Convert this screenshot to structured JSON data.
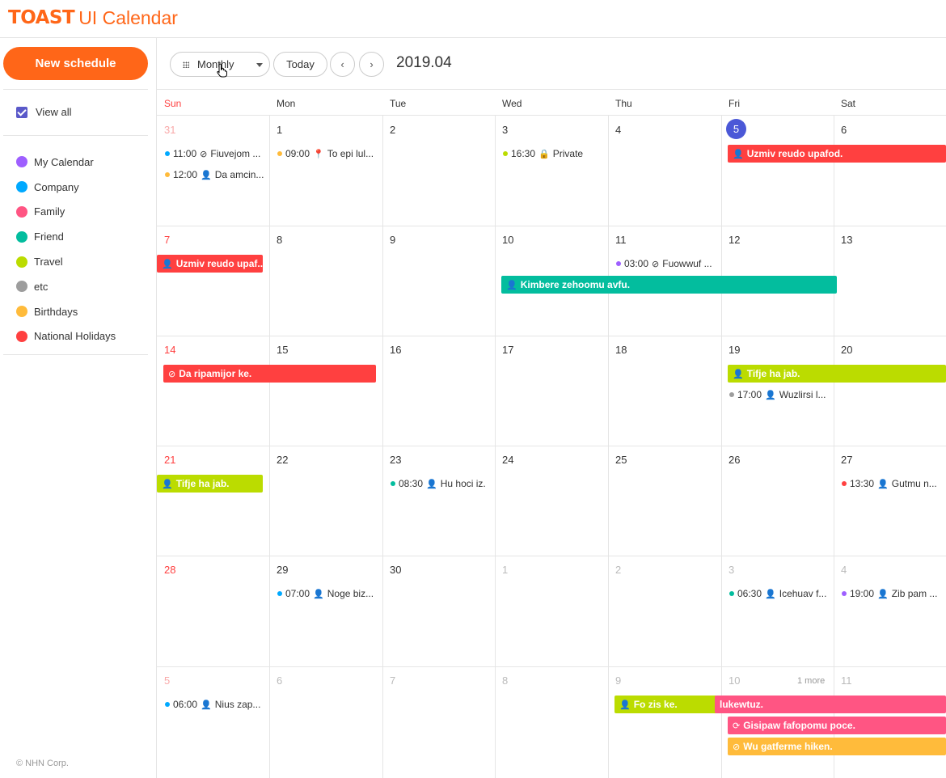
{
  "header": {
    "logo_bold": "TOAST",
    "logo_rest": "UI Calendar"
  },
  "sidebar": {
    "new_schedule": "New schedule",
    "view_all": "View all",
    "calendars": [
      {
        "label": "My Calendar",
        "color": "#9e5fff"
      },
      {
        "label": "Company",
        "color": "#00a9ff"
      },
      {
        "label": "Family",
        "color": "#ff5583"
      },
      {
        "label": "Friend",
        "color": "#03bd9e"
      },
      {
        "label": "Travel",
        "color": "#bbdc00"
      },
      {
        "label": "etc",
        "color": "#9d9d9d"
      },
      {
        "label": "Birthdays",
        "color": "#ffbb3b"
      },
      {
        "label": "National Holidays",
        "color": "#ff4040"
      }
    ],
    "copyright": "© NHN Corp."
  },
  "toolbar": {
    "view": "Monthly",
    "today": "Today",
    "prev": "‹",
    "next": "›",
    "range": "2019.04"
  },
  "daynames": [
    "Sun",
    "Mon",
    "Tue",
    "Wed",
    "Thu",
    "Fri",
    "Sat"
  ],
  "weeks": [
    [
      "31",
      "1",
      "2",
      "3",
      "4",
      "5",
      "6"
    ],
    [
      "7",
      "8",
      "9",
      "10",
      "11",
      "12",
      "13"
    ],
    [
      "14",
      "15",
      "16",
      "17",
      "18",
      "19",
      "20"
    ],
    [
      "21",
      "22",
      "23",
      "24",
      "25",
      "26",
      "27"
    ],
    [
      "28",
      "29",
      "30",
      "1",
      "2",
      "3",
      "4"
    ],
    [
      "5",
      "6",
      "7",
      "8",
      "9",
      "10",
      "11"
    ]
  ],
  "more_label": "1 more",
  "dot_events": [
    {
      "time": "11:00",
      "icon": "⊘",
      "title": "Fiuvejom ...",
      "color": "#00a9ff"
    },
    {
      "time": "12:00",
      "icon": "👤",
      "title": "Da amcin...",
      "color": "#ffbb3b"
    },
    {
      "time": "09:00",
      "icon": "📍",
      "title": "To epi lul...",
      "color": "#ffbb3b"
    },
    {
      "time": "16:30",
      "icon": "🔒",
      "title": "Private",
      "color": "#bbdc00"
    },
    {
      "time": "03:00",
      "icon": "⊘",
      "title": "Fuowwuf ...",
      "color": "#9e5fff"
    },
    {
      "time": "17:00",
      "icon": "👤",
      "title": "Wuzlirsi l...",
      "color": "#9d9d9d"
    },
    {
      "time": "08:30",
      "icon": "👤",
      "title": "Hu hoci iz.",
      "color": "#03bd9e"
    },
    {
      "time": "13:30",
      "icon": "👤",
      "title": "Gutmu n...",
      "color": "#ff4040"
    },
    {
      "time": "07:00",
      "icon": "👤",
      "title": "Noge biz...",
      "color": "#00a9ff"
    },
    {
      "time": "06:30",
      "icon": "👤",
      "title": "Icehuav f...",
      "color": "#03bd9e"
    },
    {
      "time": "19:00",
      "icon": "👤",
      "title": "Zib pam ...",
      "color": "#9e5fff"
    },
    {
      "time": "06:00",
      "icon": "👤",
      "title": "Nius zap...",
      "color": "#00a9ff"
    }
  ],
  "bar_events": [
    {
      "icon": "👤",
      "title": "Uzmiv reudo upafod.",
      "color": "#ff4040"
    },
    {
      "icon": "👤",
      "title": "Uzmiv reudo upaf...",
      "color": "#ff4040"
    },
    {
      "icon": "👤",
      "title": "Kimbere zehoomu avfu.",
      "color": "#03bd9e"
    },
    {
      "icon": "⊘",
      "title": "Da ripamijor ke.",
      "color": "#ff4040"
    },
    {
      "icon": "👤",
      "title": "Tifje ha jab.",
      "color": "#bbdc00"
    },
    {
      "icon": "👤",
      "title": "Tifje ha jab.",
      "color": "#bbdc00"
    },
    {
      "icon": "👤",
      "title": "Fo zis ke.",
      "color": "#bbdc00"
    },
    {
      "icon": "",
      "title": "lukewtuz.",
      "color": "#ff5583"
    },
    {
      "icon": "⟳",
      "title": "Gisipaw fafopomu poce.",
      "color": "#ff5583"
    },
    {
      "icon": "⊘",
      "title": "Wu gatferme hiken.",
      "color": "#ffbb3b"
    }
  ]
}
